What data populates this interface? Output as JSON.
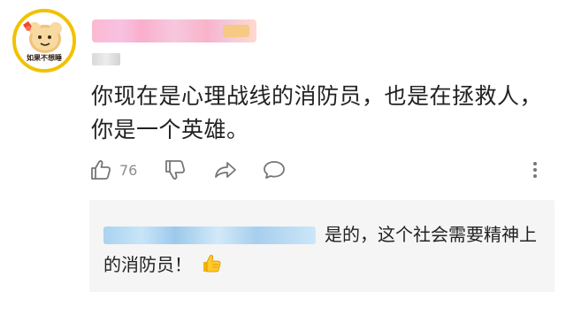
{
  "comment": {
    "avatar": {
      "caption": "如果不想睡"
    },
    "text": "你现在是心理战线的消防员，也是在拯救人，你是一个英雄。",
    "actions": {
      "like_icon": "thumbs-up-icon",
      "like_count": "76",
      "dislike_icon": "thumbs-down-icon",
      "share_icon": "share-icon",
      "reply_icon": "comment-icon",
      "more_icon": "more-vertical-icon"
    }
  },
  "reply": {
    "text": "是的，这个社会需要精神上的消防员！",
    "emoji": "👍"
  }
}
